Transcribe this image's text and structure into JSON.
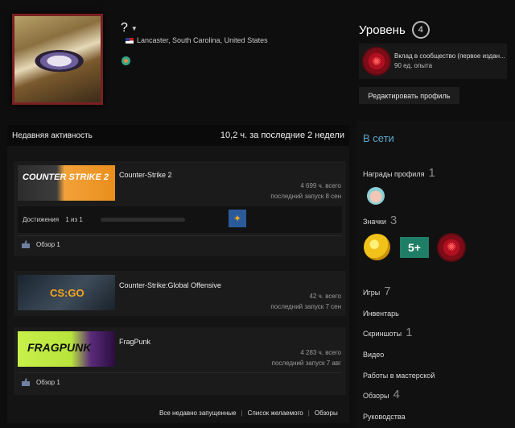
{
  "profile": {
    "persona_name": "?",
    "location": "Lancaster, South Carolina, United States"
  },
  "level": {
    "title": "Уровень",
    "value": "4",
    "badge_name": "Вклад в сообщество (первое издан...",
    "badge_xp": "90 ед. опыта",
    "edit_button": "Редактировать профиль"
  },
  "activity": {
    "title": "Недавняя активность",
    "hours_summary": "10,2 ч. за последние 2 недели",
    "games": [
      {
        "name": "Counter-Strike 2",
        "thumb_text": "COUNTER STRIKE 2",
        "hours_total": "4 699 ч. всего",
        "last_played": "последний запуск 8 сен",
        "achievements_label": "Достижения",
        "achievements_count": "1 из 1",
        "review_label": "Обзор 1"
      },
      {
        "name": "Counter-Strike:Global Offensive",
        "thumb_text": "CS:GO",
        "hours_total": "42 ч. всего",
        "last_played": "последний запуск 7 сен"
      },
      {
        "name": "FragPunk",
        "thumb_text": "FRAGPUNK",
        "hours_total": "4 283 ч. всего",
        "last_played": "последний запуск 7 авг",
        "review_label": "Обзор 1"
      }
    ],
    "footer": {
      "recent": "Все недавно запущенные",
      "wishlist": "Список желаемого",
      "reviews": "Обзоры",
      "separator": "|"
    }
  },
  "sidebar": {
    "status": "В сети",
    "awards_label": "Награды профиля",
    "awards_count": "1",
    "badges_label": "Значки",
    "badges_count": "3",
    "five_plus": "5+",
    "games_label": "Игры",
    "games_count": "7",
    "inventory_label": "Инвентарь",
    "screenshots_label": "Скриншоты",
    "screenshots_count": "1",
    "video_label": "Видео",
    "workshop_label": "Работы в мастерской",
    "reviews_label": "Обзоры",
    "reviews_count": "4",
    "guides_label": "Руководства"
  },
  "colors": {
    "background": "#0e0e0e",
    "online_blue": "#5fa7cb",
    "avatar_frame": "#7a1f22"
  }
}
